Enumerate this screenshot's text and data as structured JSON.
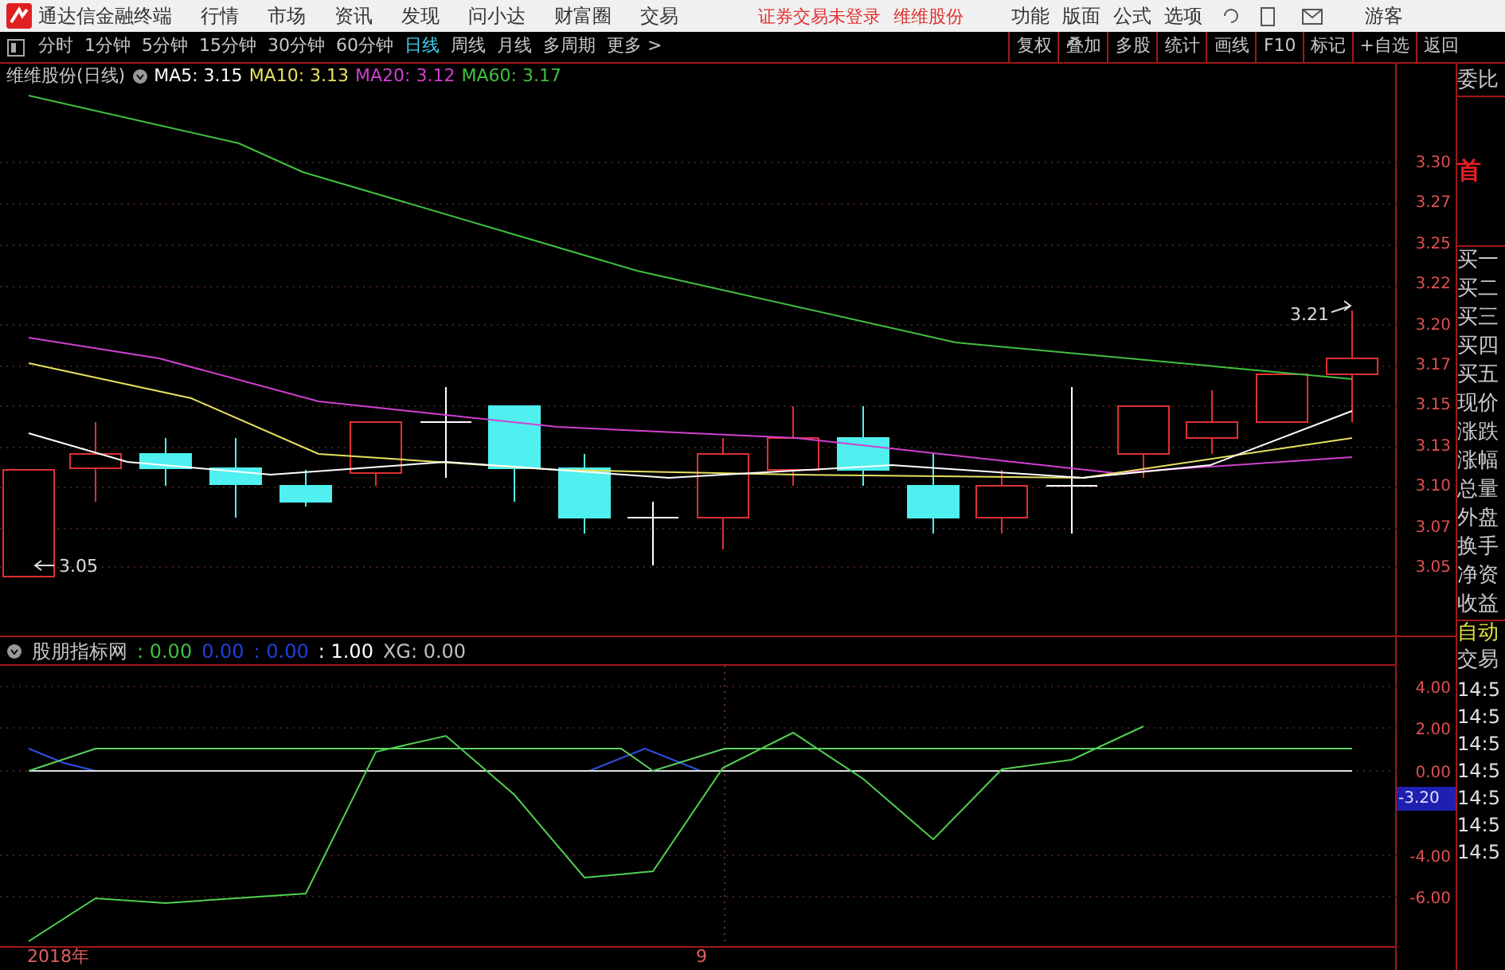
{
  "app": {
    "title": "通达信金融终端",
    "menu": [
      "行情",
      "市场",
      "资讯",
      "发现",
      "问小达",
      "财富圈",
      "交易"
    ],
    "status": "证券交易未登录",
    "stock": "维维股份",
    "menu_right": [
      "功能",
      "版面",
      "公式",
      "选项"
    ],
    "user": "游客"
  },
  "period_tabs": [
    {
      "label": "分时",
      "selected": false
    },
    {
      "label": "1分钟",
      "selected": false
    },
    {
      "label": "5分钟",
      "selected": false
    },
    {
      "label": "15分钟",
      "selected": false
    },
    {
      "label": "30分钟",
      "selected": false
    },
    {
      "label": "60分钟",
      "selected": false
    },
    {
      "label": "日线",
      "selected": true
    },
    {
      "label": "周线",
      "selected": false
    },
    {
      "label": "月线",
      "selected": false
    },
    {
      "label": "多周期",
      "selected": false
    },
    {
      "label": "更多 >",
      "selected": false
    }
  ],
  "tool_buttons": [
    "复权",
    "叠加",
    "多股",
    "统计",
    "画线",
    "F10",
    "标记",
    "+自选",
    "返回"
  ],
  "main_chart": {
    "title": "维维股份(日线)",
    "legend": [
      {
        "label": "MA5: 3.15",
        "color": "#ffffff"
      },
      {
        "label": "MA10: 3.13",
        "color": "#e8e060"
      },
      {
        "label": "MA20: 3.12",
        "color": "#d040d0"
      },
      {
        "label": "MA60: 3.17",
        "color": "#40c040"
      }
    ],
    "high_label": "3.21",
    "low_label": "3.05"
  },
  "price_axis": [
    "3.30",
    "3.27",
    "3.25",
    "3.22",
    "3.20",
    "3.17",
    "3.15",
    "3.13",
    "3.10",
    "3.07",
    "3.05"
  ],
  "indicator": {
    "title": "股朋指标网",
    "values": [
      {
        "label": ": 0.00",
        "color": "#40c040"
      },
      {
        "label": "0.00",
        "color": "#2040e0"
      },
      {
        "label": ": 0.00",
        "color": "#2040e0"
      },
      {
        "label": ": 1.00",
        "color": "#ffffff"
      },
      {
        "label": "XG: 0.00",
        "color": "#c0c0c0"
      }
    ]
  },
  "indicator_axis": [
    "4.00",
    "2.00",
    "0.00",
    "-4.00",
    "-6.00"
  ],
  "indicator_marker": "-3.20",
  "date_axis": [
    "2018年",
    "9"
  ],
  "quote_panel": {
    "header": "委比",
    "badge": "首",
    "rows": [
      "买一",
      "买二",
      "买三",
      "买四",
      "买五",
      "现价",
      "涨跌",
      "涨幅",
      "总量",
      "外盘",
      "换手",
      "净资",
      "收益"
    ],
    "mode": "自动",
    "trade_label": "交易",
    "times": [
      "14:5",
      "14:5",
      "14:5",
      "14:5",
      "14:5",
      "14:5",
      "14:5"
    ]
  }
}
